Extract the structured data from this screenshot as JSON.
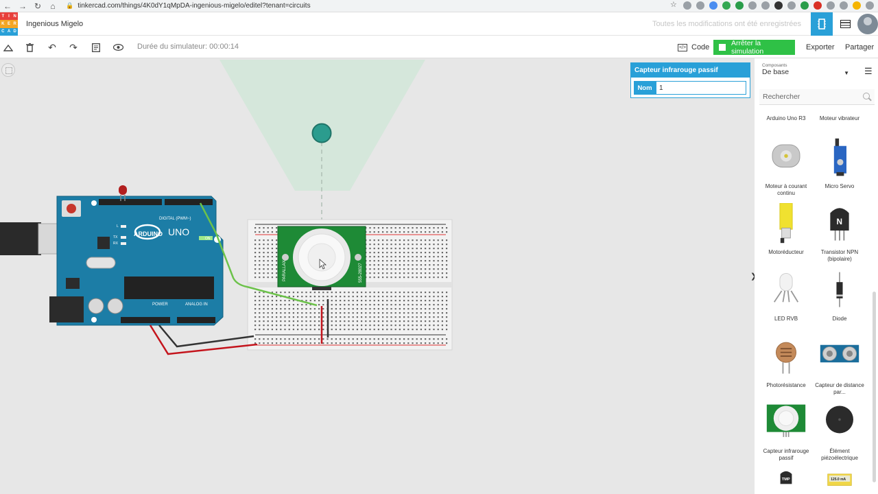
{
  "browser": {
    "url": "tinkercad.com/things/4K0dY1qMpDA-ingenious-migelo/editel?tenant=circuits"
  },
  "header": {
    "logo_letters": [
      "T",
      "I",
      "N",
      "K",
      "E",
      "R",
      "C",
      "A",
      "D"
    ],
    "logo_colors": [
      "#e8403c",
      "#e8403c",
      "#e8403c",
      "#f5a623",
      "#f5a623",
      "#f5a623",
      "#29a0d8",
      "#29a0d8",
      "#29a0d8"
    ],
    "project_name": "Ingenious Migelo",
    "save_status": "Toutes les modifications ont été enregistrées"
  },
  "toolbar": {
    "sim_time_label": "Durée du simulateur: 00:00:14",
    "code_label": "Code",
    "stop_label": "Arrêter la simulation",
    "export_label": "Exporter",
    "share_label": "Partager"
  },
  "inspector": {
    "title": "Capteur infrarouge passif",
    "name_label": "Nom",
    "name_value": "1"
  },
  "arduino": {
    "brand": "ARDUINO",
    "model": "UNO",
    "digital_label": "DIGITAL (PWM~)",
    "analog_label": "ANALOG IN",
    "power_label": "POWER",
    "on_label": "ON",
    "led_l": "L",
    "led_tx": "TX",
    "led_rx": "RX"
  },
  "pir": {
    "left_text": "PARALLAX",
    "right_text": "555-28027"
  },
  "panel": {
    "category_label": "Composants",
    "category_value": "De base",
    "search_placeholder": "Rechercher",
    "components": [
      {
        "label": "Arduino Uno R3",
        "icon": "arduino-icon"
      },
      {
        "label": "Moteur vibrateur",
        "icon": "vibration-motor-icon"
      },
      {
        "label": "Moteur à courant continu",
        "icon": "dc-motor-icon"
      },
      {
        "label": "Micro Servo",
        "icon": "servo-icon"
      },
      {
        "label": "Motoréducteur",
        "icon": "gear-motor-icon"
      },
      {
        "label": "Transistor NPN (bipolaire)",
        "icon": "npn-transistor-icon"
      },
      {
        "label": "LED RVB",
        "icon": "rgb-led-icon"
      },
      {
        "label": "Diode",
        "icon": "diode-icon"
      },
      {
        "label": "Photorésistance",
        "icon": "photoresistor-icon"
      },
      {
        "label": "Capteur de distance par...",
        "icon": "ultrasonic-sensor-icon"
      },
      {
        "label": "Capteur infrarouge passif",
        "icon": "pir-sensor-icon"
      },
      {
        "label": "Élément piézoélectrique",
        "icon": "piezo-icon"
      },
      {
        "label": "TMP",
        "icon": "temperature-sensor-icon"
      },
      {
        "label": "125.0 mA",
        "icon": "multimeter-icon"
      }
    ],
    "transistor_mark": "N"
  }
}
